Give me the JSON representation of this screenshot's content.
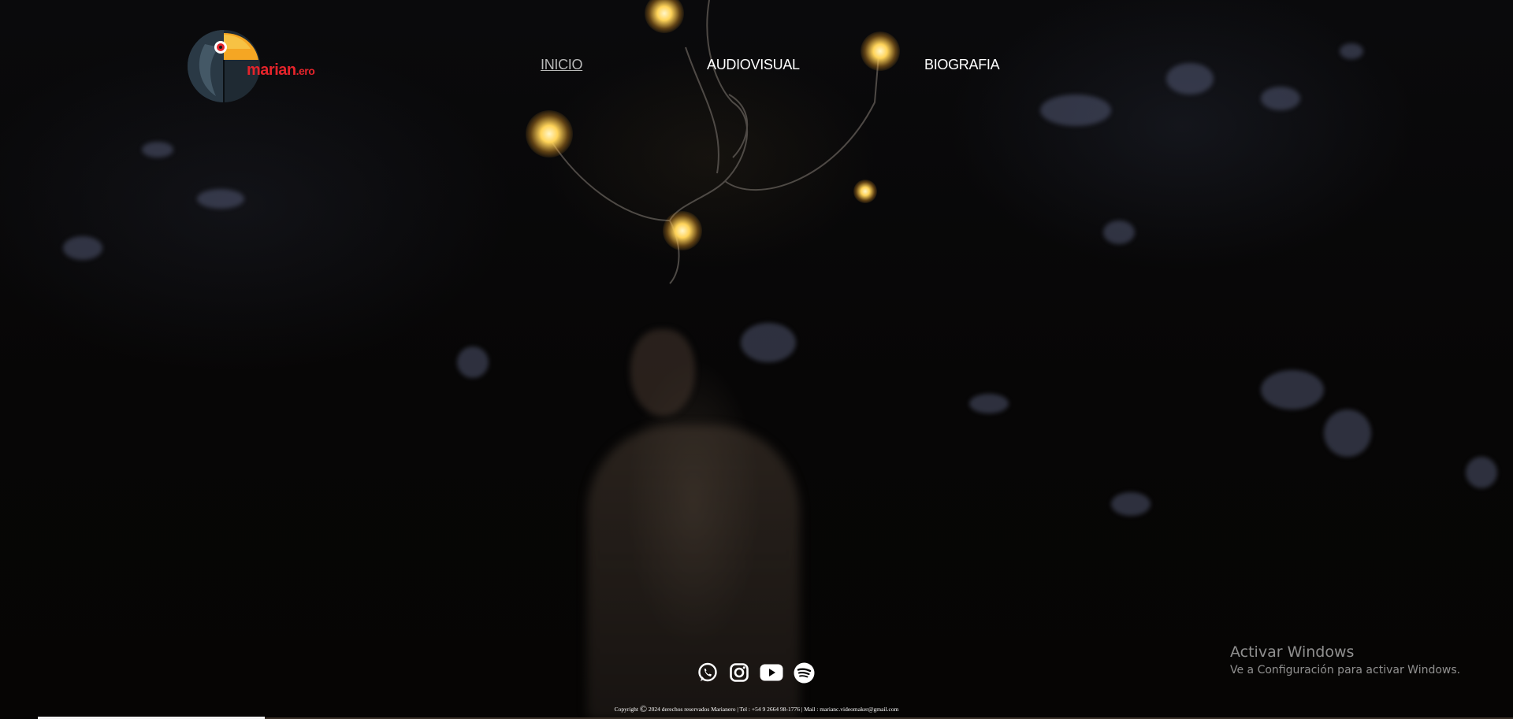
{
  "logo": {
    "text_main": "marian",
    "text_suffix": ".ero",
    "colors": {
      "red": "#e4242b",
      "orange": "#f5a623",
      "dark": "#1f2a33"
    }
  },
  "nav": {
    "items": [
      {
        "label": "INICIO",
        "active": true
      },
      {
        "label": "AUDIOVISUAL",
        "active": false
      },
      {
        "label": "BIOGRAFIA",
        "active": false
      }
    ]
  },
  "socials": [
    {
      "icon": "whatsapp-icon"
    },
    {
      "icon": "instagram-icon"
    },
    {
      "icon": "youtube-icon"
    },
    {
      "icon": "spotify-icon"
    }
  ],
  "footer": {
    "copyright_prefix": "Copyright",
    "copyright_symbol": "©",
    "copyright_text": "2024 derechos reservados Marianero | Tel : +54 9 2664 98-1776 | Mail : marianc.videomaker@gmail.com"
  },
  "windows_watermark": {
    "title": "Activar Windows",
    "subtitle": "Ve a Configuración para activar Windows."
  }
}
